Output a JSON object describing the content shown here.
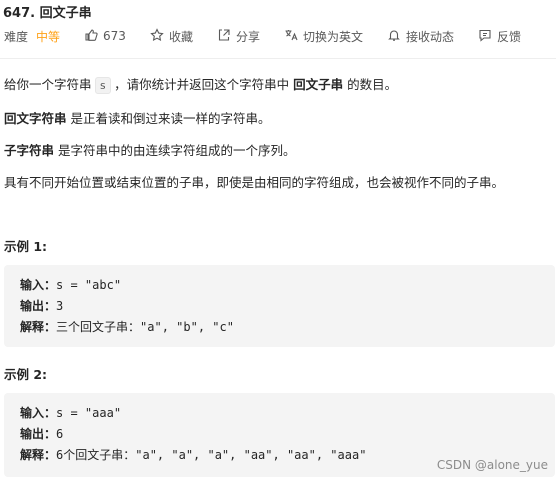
{
  "header": {
    "title": "647. 回文子串",
    "difficulty_label": "难度",
    "difficulty_value": "中等",
    "likes": "673",
    "favorite": "收藏",
    "share": "分享",
    "switch_lang": "切换为英文",
    "notify": "接收动态",
    "feedback": "反馈"
  },
  "description": {
    "p1_a": "给你一个字符串",
    "p1_code": "s",
    "p1_b": "，请你统计并返回这个字符串中",
    "p1_bold": "回文子串",
    "p1_c": "的数目。",
    "p2_bold": "回文字符串",
    "p2_rest": "是正着读和倒过来读一样的字符串。",
    "p3_bold": "子字符串",
    "p3_rest": "是字符串中的由连续字符组成的一个序列。",
    "p4": "具有不同开始位置或结束位置的子串，即使是由相同的字符组成，也会被视作不同的子串。"
  },
  "examples": [
    {
      "title": "示例 1:",
      "input_label": "输入：",
      "input_value": "s = \"abc\"",
      "output_label": "输出：",
      "output_value": "3",
      "explain_label": "解释：",
      "explain_value": "三个回文子串：\"a\", \"b\", \"c\""
    },
    {
      "title": "示例 2:",
      "input_label": "输入：",
      "input_value": "s = \"aaa\"",
      "output_label": "输出：",
      "output_value": "6",
      "explain_label": "解释：",
      "explain_value": "6个回文子串：\"a\", \"a\", \"a\", \"aa\", \"aa\", \"aaa\""
    }
  ],
  "watermark": "CSDN @alone_yue",
  "colors": {
    "difficulty": "#ffa116",
    "code_bg": "#f4f4f4"
  },
  "icons": {
    "like": "thumbs-up-icon",
    "favorite": "star-icon",
    "share": "share-icon",
    "switch_lang": "translate-icon",
    "notify": "bell-icon",
    "feedback": "feedback-icon"
  }
}
